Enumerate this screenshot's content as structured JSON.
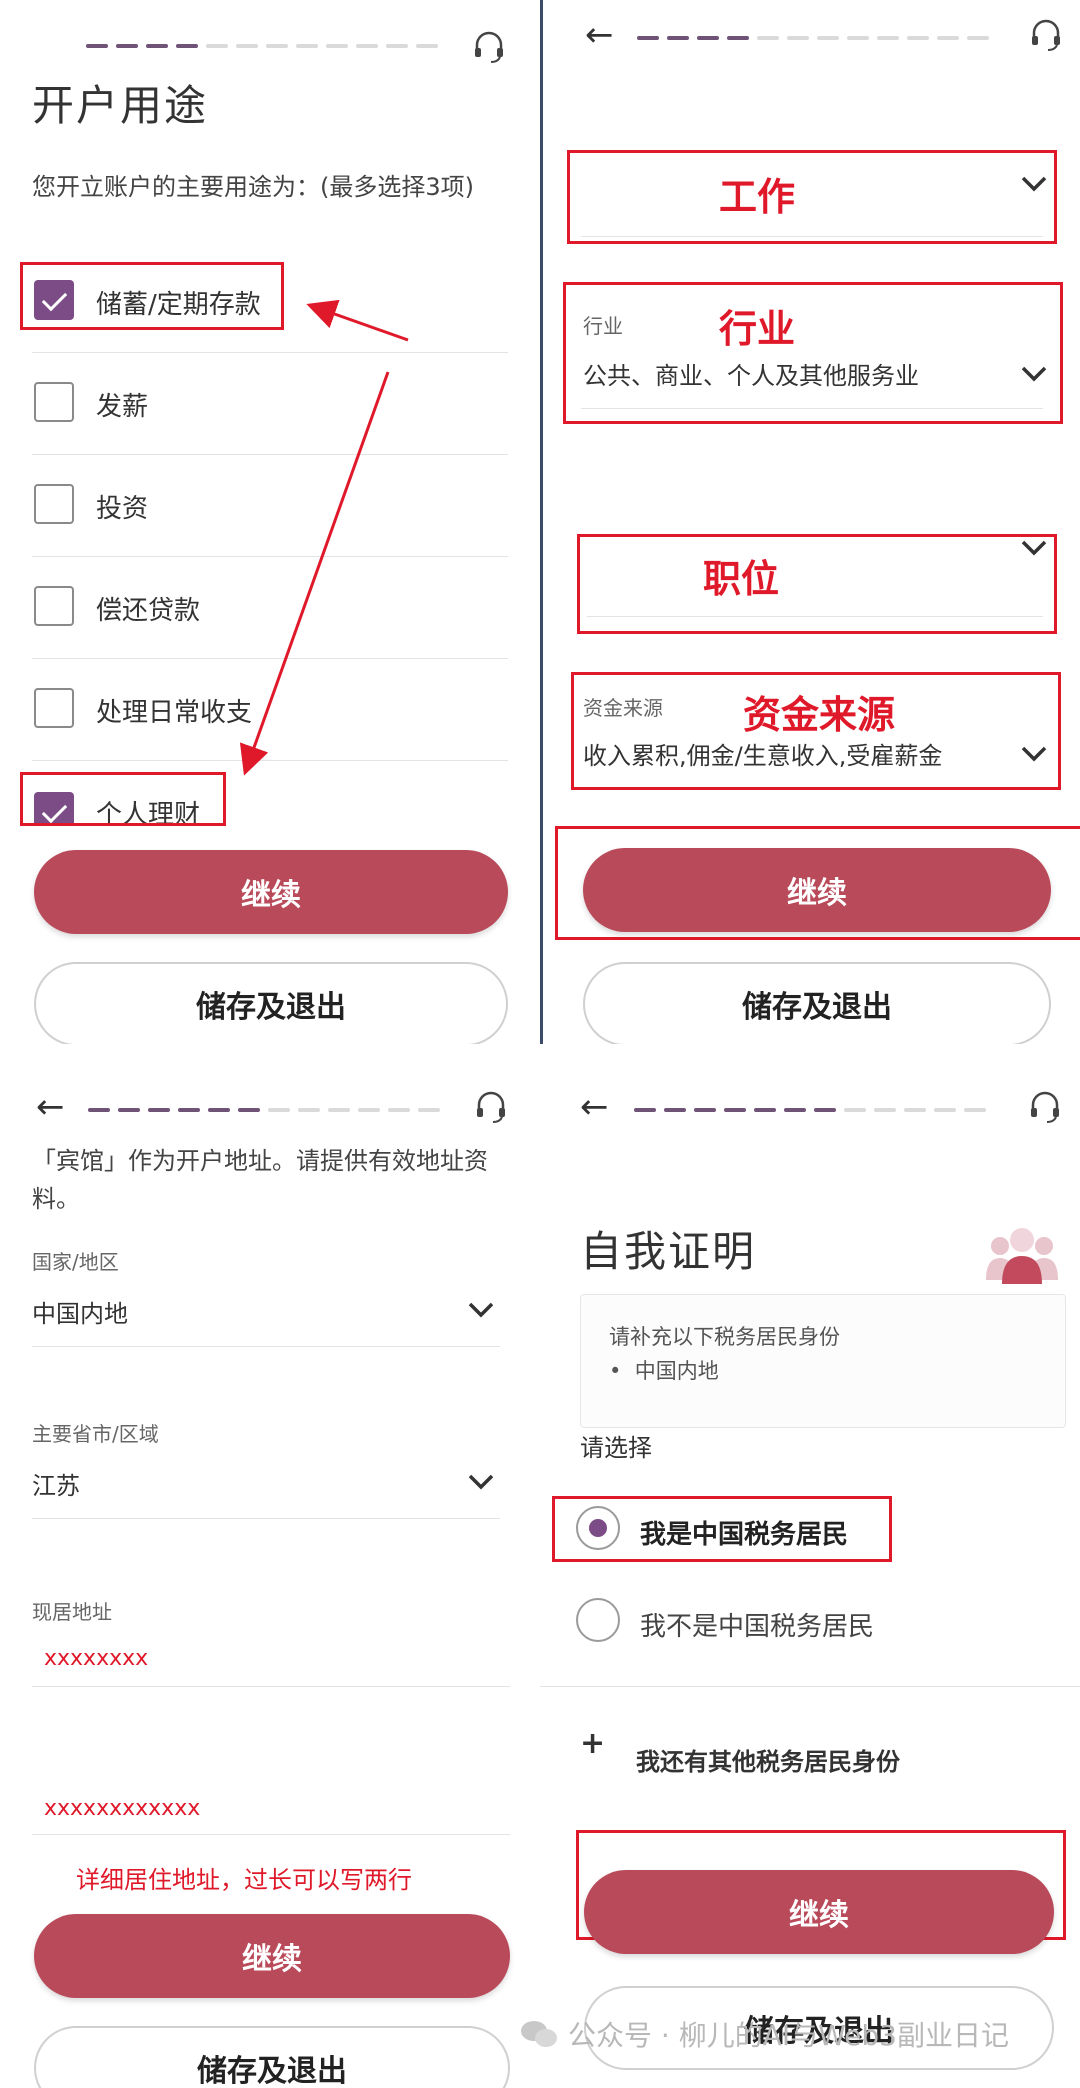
{
  "panel1": {
    "title": "开户用途",
    "question": "您开立账户的主要用途为：(最多选择3项)",
    "options": [
      {
        "label": "储蓄/定期存款",
        "checked": true
      },
      {
        "label": "发薪",
        "checked": false
      },
      {
        "label": "投资",
        "checked": false
      },
      {
        "label": "偿还贷款",
        "checked": false
      },
      {
        "label": "处理日常收支",
        "checked": false
      },
      {
        "label": "个人理财",
        "checked": true
      }
    ],
    "continue_label": "继续",
    "save_exit_label": "储存及退出"
  },
  "panel2": {
    "annot_work": "工作",
    "industry_label": "行业",
    "annot_industry": "行业",
    "industry_value": "公共、商业、个人及其他服务业",
    "annot_position": "职位",
    "source_label": "资金来源",
    "annot_source": "资金来源",
    "source_value": "收入累积,佣金/生意收入,受雇薪金",
    "continue_label": "继续",
    "save_exit_label": "储存及退出"
  },
  "panel3": {
    "notice": "「宾馆」作为开户地址。请提供有效地址资料。",
    "country_label": "国家/地区",
    "country_value": "中国内地",
    "province_label": "主要省市/区域",
    "province_value": "江苏",
    "address_label": "现居地址",
    "address_line1": "xxxxxxxx",
    "address_line2": "xxxxxxxxxxxx",
    "hint": "详细居住地址，过长可以写两行",
    "continue_label": "继续",
    "save_exit_label": "储存及退出"
  },
  "panel4": {
    "title": "自我证明",
    "info_title": "请补充以下税务居民身份",
    "info_item": "中国内地",
    "choose_label": "请选择",
    "option_resident": "我是中国税务居民",
    "option_non_resident": "我不是中国税务居民",
    "add_other": "我还有其他税务居民身份",
    "continue_label": "继续",
    "save_exit_label": "储存及退出"
  },
  "watermark": "公众号 · 柳儿的AI与Web3副业日记",
  "colors": {
    "accent": "#b94a5a",
    "checkbox": "#7b4c86",
    "annotation": "#e0192a",
    "progress_done": "#6e5377"
  }
}
